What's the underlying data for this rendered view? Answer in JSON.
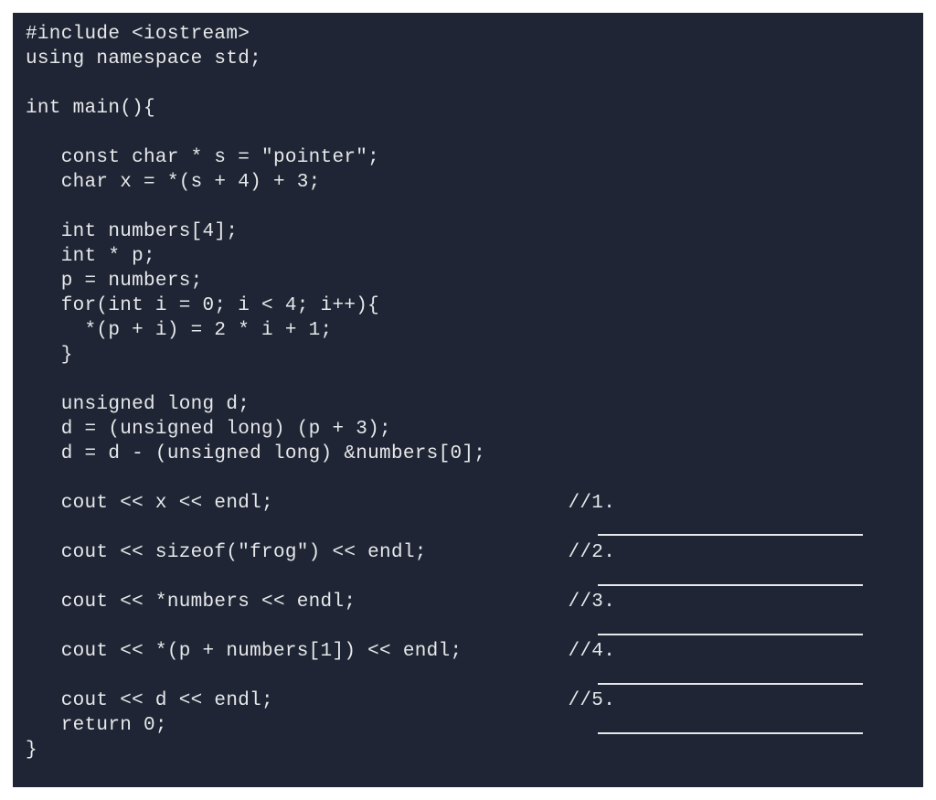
{
  "colors": {
    "bg": "#1f2534",
    "fg": "#e6e8ea"
  },
  "code": {
    "l01": "#include <iostream>",
    "l02": "using namespace std;",
    "l03": "",
    "l04": "int main(){",
    "l05": "",
    "l06": "   const char * s = \"pointer\";",
    "l07": "   char x = *(s + 4) + 3;",
    "l08": "",
    "l09": "   int numbers[4];",
    "l10": "   int * p;",
    "l11": "   p = numbers;",
    "l12": "   for(int i = 0; i < 4; i++){",
    "l13": "     *(p + i) = 2 * i + 1;",
    "l14": "   }",
    "l15": "",
    "l16": "   unsigned long d;",
    "l17": "   d = (unsigned long) (p + 3);",
    "l18": "   d = d - (unsigned long) &numbers[0];",
    "l19": "",
    "l20": "   cout << x << endl;                         //1.",
    "l21": "",
    "l22": "   cout << sizeof(\"frog\") << endl;            //2.",
    "l23": "",
    "l24": "   cout << *numbers << endl;                  //3.",
    "l25": "",
    "l26": "   cout << *(p + numbers[1]) << endl;         //4.",
    "l27": "",
    "l28": "   cout << d << endl;                         //5.",
    "l29": "   return 0;",
    "l30": "}"
  }
}
